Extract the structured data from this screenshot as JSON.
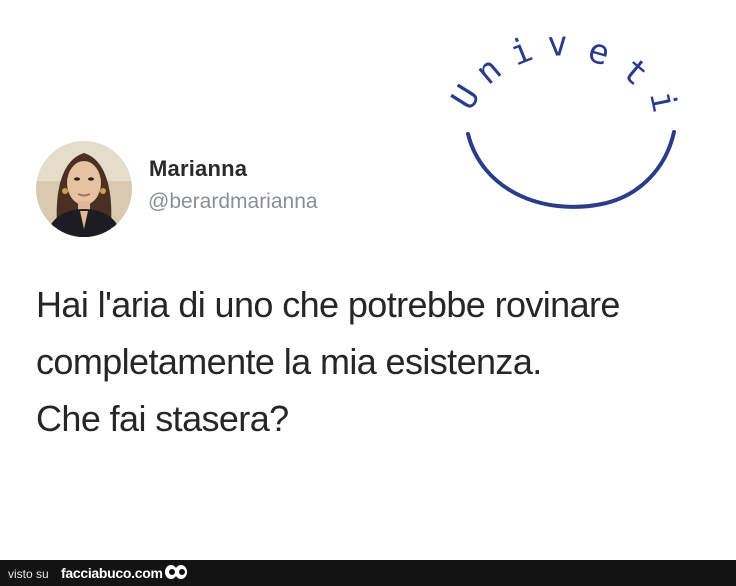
{
  "tweet": {
    "display_name": "Marianna",
    "handle": "@berardmarianna",
    "text_lines": [
      "Hai l'aria di uno che potrebbe rovinare",
      "completamente la mia esistenza.",
      "Che fai stasera?"
    ]
  },
  "watermark": {
    "letters": [
      "U",
      "n",
      "i",
      "v",
      "e",
      "t",
      "i"
    ],
    "color": "#2a3d8a"
  },
  "footer": {
    "prefix": "visto su",
    "site": "facciabuco.com",
    "background": "#131313"
  }
}
